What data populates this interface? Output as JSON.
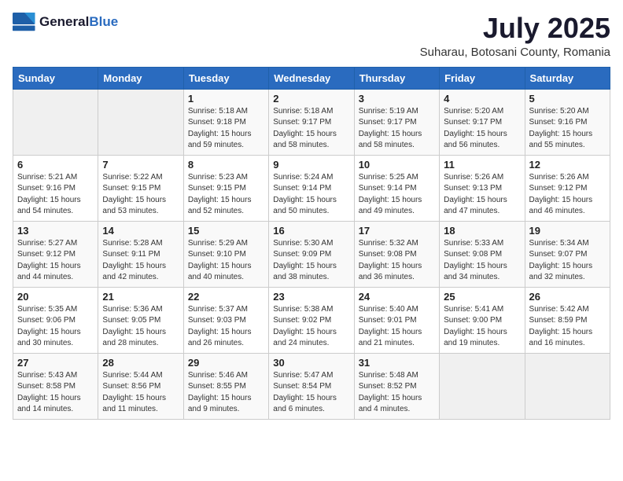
{
  "header": {
    "logo_general": "General",
    "logo_blue": "Blue",
    "title": "July 2025",
    "subtitle": "Suharau, Botosani County, Romania"
  },
  "calendar": {
    "days_of_week": [
      "Sunday",
      "Monday",
      "Tuesday",
      "Wednesday",
      "Thursday",
      "Friday",
      "Saturday"
    ],
    "weeks": [
      [
        {
          "day": "",
          "sunrise": "",
          "sunset": "",
          "daylight": "",
          "empty": true
        },
        {
          "day": "",
          "sunrise": "",
          "sunset": "",
          "daylight": "",
          "empty": true
        },
        {
          "day": "1",
          "sunrise": "Sunrise: 5:18 AM",
          "sunset": "Sunset: 9:18 PM",
          "daylight": "Daylight: 15 hours and 59 minutes.",
          "empty": false
        },
        {
          "day": "2",
          "sunrise": "Sunrise: 5:18 AM",
          "sunset": "Sunset: 9:17 PM",
          "daylight": "Daylight: 15 hours and 58 minutes.",
          "empty": false
        },
        {
          "day": "3",
          "sunrise": "Sunrise: 5:19 AM",
          "sunset": "Sunset: 9:17 PM",
          "daylight": "Daylight: 15 hours and 58 minutes.",
          "empty": false
        },
        {
          "day": "4",
          "sunrise": "Sunrise: 5:20 AM",
          "sunset": "Sunset: 9:17 PM",
          "daylight": "Daylight: 15 hours and 56 minutes.",
          "empty": false
        },
        {
          "day": "5",
          "sunrise": "Sunrise: 5:20 AM",
          "sunset": "Sunset: 9:16 PM",
          "daylight": "Daylight: 15 hours and 55 minutes.",
          "empty": false
        }
      ],
      [
        {
          "day": "6",
          "sunrise": "Sunrise: 5:21 AM",
          "sunset": "Sunset: 9:16 PM",
          "daylight": "Daylight: 15 hours and 54 minutes.",
          "empty": false
        },
        {
          "day": "7",
          "sunrise": "Sunrise: 5:22 AM",
          "sunset": "Sunset: 9:15 PM",
          "daylight": "Daylight: 15 hours and 53 minutes.",
          "empty": false
        },
        {
          "day": "8",
          "sunrise": "Sunrise: 5:23 AM",
          "sunset": "Sunset: 9:15 PM",
          "daylight": "Daylight: 15 hours and 52 minutes.",
          "empty": false
        },
        {
          "day": "9",
          "sunrise": "Sunrise: 5:24 AM",
          "sunset": "Sunset: 9:14 PM",
          "daylight": "Daylight: 15 hours and 50 minutes.",
          "empty": false
        },
        {
          "day": "10",
          "sunrise": "Sunrise: 5:25 AM",
          "sunset": "Sunset: 9:14 PM",
          "daylight": "Daylight: 15 hours and 49 minutes.",
          "empty": false
        },
        {
          "day": "11",
          "sunrise": "Sunrise: 5:26 AM",
          "sunset": "Sunset: 9:13 PM",
          "daylight": "Daylight: 15 hours and 47 minutes.",
          "empty": false
        },
        {
          "day": "12",
          "sunrise": "Sunrise: 5:26 AM",
          "sunset": "Sunset: 9:12 PM",
          "daylight": "Daylight: 15 hours and 46 minutes.",
          "empty": false
        }
      ],
      [
        {
          "day": "13",
          "sunrise": "Sunrise: 5:27 AM",
          "sunset": "Sunset: 9:12 PM",
          "daylight": "Daylight: 15 hours and 44 minutes.",
          "empty": false
        },
        {
          "day": "14",
          "sunrise": "Sunrise: 5:28 AM",
          "sunset": "Sunset: 9:11 PM",
          "daylight": "Daylight: 15 hours and 42 minutes.",
          "empty": false
        },
        {
          "day": "15",
          "sunrise": "Sunrise: 5:29 AM",
          "sunset": "Sunset: 9:10 PM",
          "daylight": "Daylight: 15 hours and 40 minutes.",
          "empty": false
        },
        {
          "day": "16",
          "sunrise": "Sunrise: 5:30 AM",
          "sunset": "Sunset: 9:09 PM",
          "daylight": "Daylight: 15 hours and 38 minutes.",
          "empty": false
        },
        {
          "day": "17",
          "sunrise": "Sunrise: 5:32 AM",
          "sunset": "Sunset: 9:08 PM",
          "daylight": "Daylight: 15 hours and 36 minutes.",
          "empty": false
        },
        {
          "day": "18",
          "sunrise": "Sunrise: 5:33 AM",
          "sunset": "Sunset: 9:08 PM",
          "daylight": "Daylight: 15 hours and 34 minutes.",
          "empty": false
        },
        {
          "day": "19",
          "sunrise": "Sunrise: 5:34 AM",
          "sunset": "Sunset: 9:07 PM",
          "daylight": "Daylight: 15 hours and 32 minutes.",
          "empty": false
        }
      ],
      [
        {
          "day": "20",
          "sunrise": "Sunrise: 5:35 AM",
          "sunset": "Sunset: 9:06 PM",
          "daylight": "Daylight: 15 hours and 30 minutes.",
          "empty": false
        },
        {
          "day": "21",
          "sunrise": "Sunrise: 5:36 AM",
          "sunset": "Sunset: 9:05 PM",
          "daylight": "Daylight: 15 hours and 28 minutes.",
          "empty": false
        },
        {
          "day": "22",
          "sunrise": "Sunrise: 5:37 AM",
          "sunset": "Sunset: 9:03 PM",
          "daylight": "Daylight: 15 hours and 26 minutes.",
          "empty": false
        },
        {
          "day": "23",
          "sunrise": "Sunrise: 5:38 AM",
          "sunset": "Sunset: 9:02 PM",
          "daylight": "Daylight: 15 hours and 24 minutes.",
          "empty": false
        },
        {
          "day": "24",
          "sunrise": "Sunrise: 5:40 AM",
          "sunset": "Sunset: 9:01 PM",
          "daylight": "Daylight: 15 hours and 21 minutes.",
          "empty": false
        },
        {
          "day": "25",
          "sunrise": "Sunrise: 5:41 AM",
          "sunset": "Sunset: 9:00 PM",
          "daylight": "Daylight: 15 hours and 19 minutes.",
          "empty": false
        },
        {
          "day": "26",
          "sunrise": "Sunrise: 5:42 AM",
          "sunset": "Sunset: 8:59 PM",
          "daylight": "Daylight: 15 hours and 16 minutes.",
          "empty": false
        }
      ],
      [
        {
          "day": "27",
          "sunrise": "Sunrise: 5:43 AM",
          "sunset": "Sunset: 8:58 PM",
          "daylight": "Daylight: 15 hours and 14 minutes.",
          "empty": false
        },
        {
          "day": "28",
          "sunrise": "Sunrise: 5:44 AM",
          "sunset": "Sunset: 8:56 PM",
          "daylight": "Daylight: 15 hours and 11 minutes.",
          "empty": false
        },
        {
          "day": "29",
          "sunrise": "Sunrise: 5:46 AM",
          "sunset": "Sunset: 8:55 PM",
          "daylight": "Daylight: 15 hours and 9 minutes.",
          "empty": false
        },
        {
          "day": "30",
          "sunrise": "Sunrise: 5:47 AM",
          "sunset": "Sunset: 8:54 PM",
          "daylight": "Daylight: 15 hours and 6 minutes.",
          "empty": false
        },
        {
          "day": "31",
          "sunrise": "Sunrise: 5:48 AM",
          "sunset": "Sunset: 8:52 PM",
          "daylight": "Daylight: 15 hours and 4 minutes.",
          "empty": false
        },
        {
          "day": "",
          "sunrise": "",
          "sunset": "",
          "daylight": "",
          "empty": true
        },
        {
          "day": "",
          "sunrise": "",
          "sunset": "",
          "daylight": "",
          "empty": true
        }
      ]
    ]
  }
}
